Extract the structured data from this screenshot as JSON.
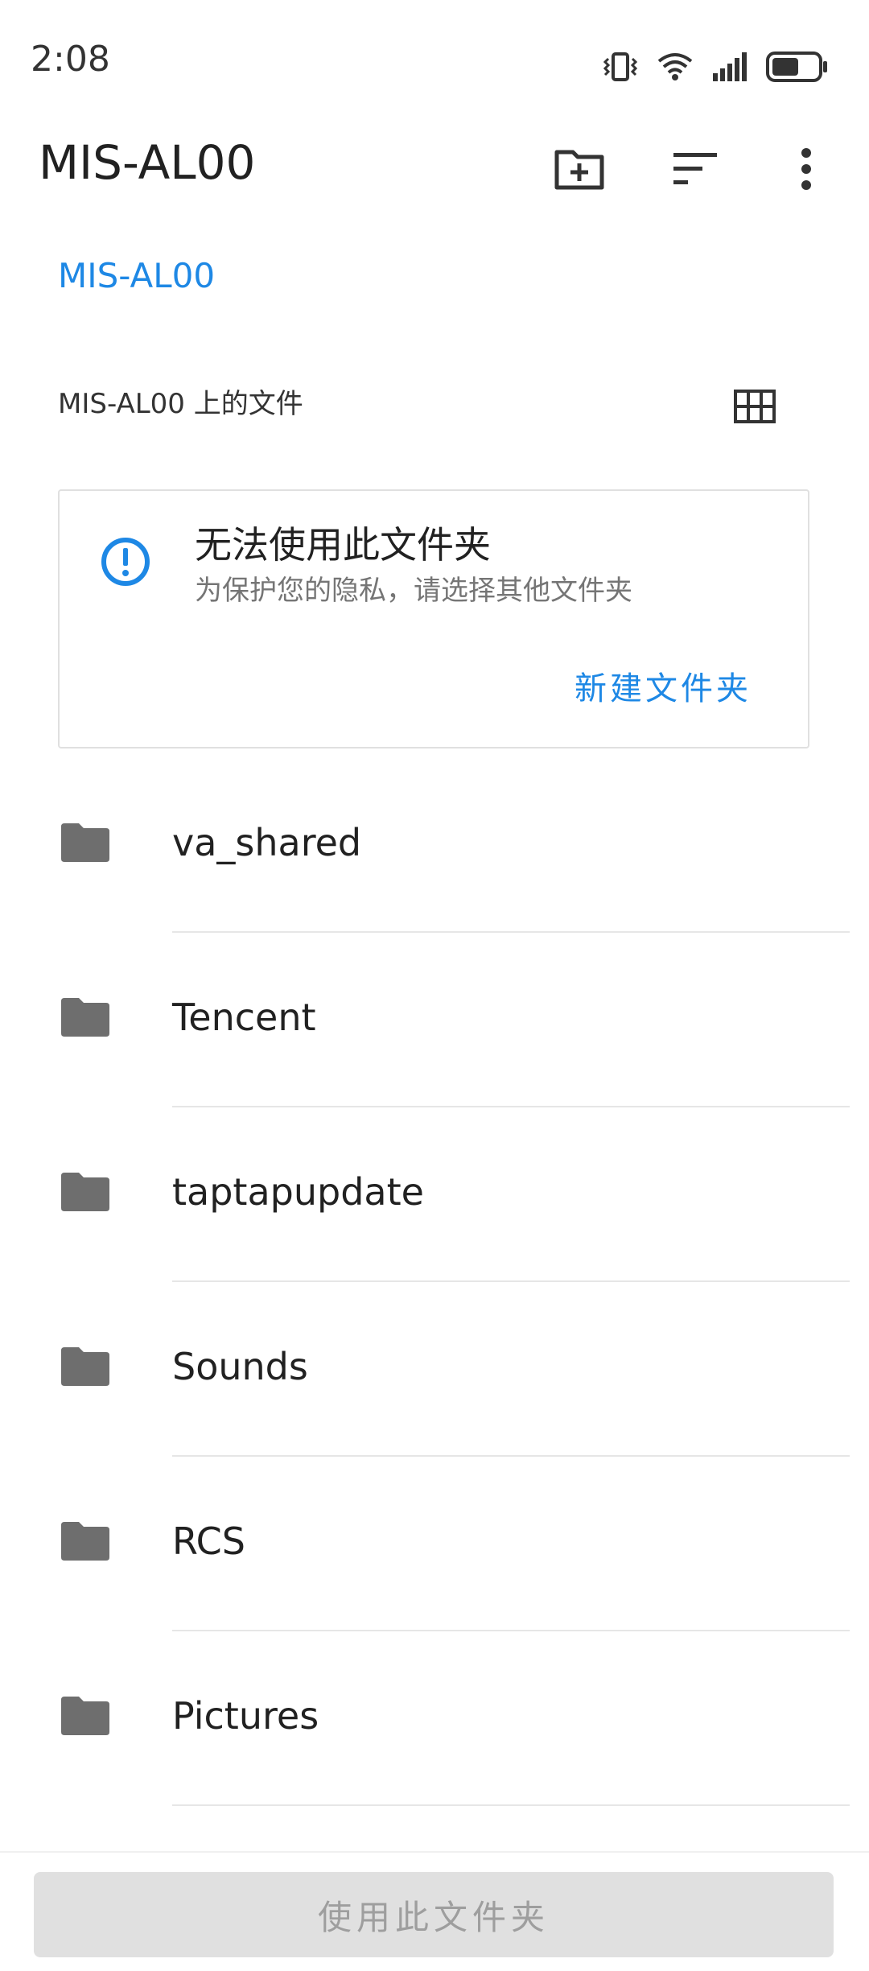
{
  "status_bar": {
    "time": "2:08",
    "battery_level": 0.6,
    "icons": [
      "vibrate-icon",
      "wifi-icon",
      "signal-icon",
      "battery-icon"
    ]
  },
  "app_bar": {
    "title": "MIS-AL00",
    "actions": [
      "new-folder-icon",
      "sort-icon",
      "more-vert-icon"
    ]
  },
  "breadcrumb": {
    "root": "MIS-AL00"
  },
  "section": {
    "header": "MIS-AL00 上的文件",
    "view_toggle_icon": "grid-view-icon"
  },
  "warning": {
    "title": "无法使用此文件夹",
    "subtitle": "为保护您的隐私，请选择其他文件夹",
    "action": "新建文件夹",
    "icon": "info-icon"
  },
  "folders": [
    {
      "name": "va_shared"
    },
    {
      "name": "Tencent"
    },
    {
      "name": "taptapupdate"
    },
    {
      "name": "Sounds"
    },
    {
      "name": "RCS"
    },
    {
      "name": "Pictures"
    }
  ],
  "bottom": {
    "use_folder_label": "使用此文件夹"
  },
  "colors": {
    "accent": "#1e88e5",
    "folder_icon": "#6e6e6e",
    "disabled_button": "#e0e0e0"
  }
}
